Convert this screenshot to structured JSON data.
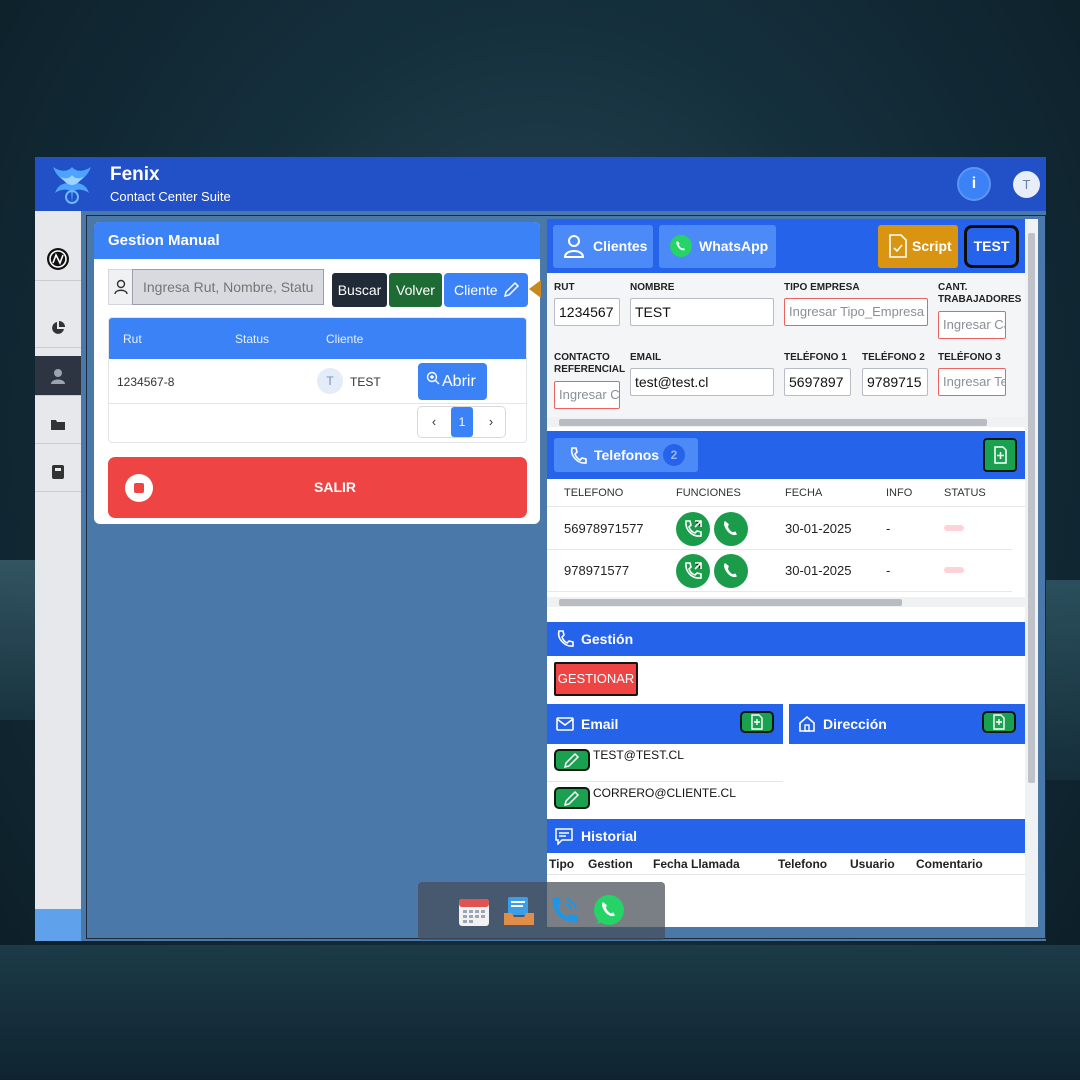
{
  "app": {
    "title": "Fenix",
    "subtitle": "Contact Center Suite",
    "user_initial": "T",
    "info_icon": "i"
  },
  "sidebar": {
    "items": [
      "brand-icon",
      "pie-chart-icon",
      "user-icon",
      "folder-icon",
      "book-icon"
    ]
  },
  "gestion_manual": {
    "title": "Gestion Manual",
    "search_placeholder": "Ingresa Rut, Nombre, Status",
    "buttons": {
      "buscar": "Buscar",
      "volver": "Volver",
      "cliente": "Cliente"
    },
    "table": {
      "headers": [
        "Rut",
        "Status",
        "Cliente"
      ],
      "rows": [
        {
          "rut": "1234567-8",
          "status": "",
          "avatar": "T",
          "cliente": "TEST",
          "action": "Abrir"
        }
      ]
    },
    "pagination": {
      "current": "1"
    },
    "salir": "SALIR"
  },
  "cliente_panel": {
    "tabs": {
      "clientes": "Clientes",
      "whatsapp": "WhatsApp",
      "script": "Script",
      "test": "TEST"
    },
    "form": {
      "rut": {
        "label": "RUT",
        "value": "1234567"
      },
      "nombre": {
        "label": "NOMBRE",
        "value": "TEST"
      },
      "tipo_empresa": {
        "label": "TIPO EMPRESA",
        "placeholder": "Ingresar Tipo_Empresa"
      },
      "cant_trabajadores": {
        "label": "CANT. TRABAJADORES",
        "placeholder": "Ingresar Cant"
      },
      "contacto_referencial": {
        "label": "CONTACTO REFERENCIAL",
        "placeholder": "Ingresar Contacto"
      },
      "email": {
        "label": "EMAIL",
        "value": "test@test.cl"
      },
      "telefono1": {
        "label": "TELÉFONO 1",
        "value": "5697897"
      },
      "telefono2": {
        "label": "TELÉFONO 2",
        "value": "9789715"
      },
      "telefono3": {
        "label": "TELÉFONO 3",
        "placeholder": "Ingresar Telefono"
      }
    },
    "telefonos": {
      "title": "Telefonos",
      "count": "2",
      "headers": [
        "TELEFONO",
        "FUNCIONES",
        "FECHA",
        "INFO",
        "STATUS"
      ],
      "rows": [
        {
          "telefono": "56978971577",
          "fecha": "30-01-2025",
          "info": "-"
        },
        {
          "telefono": "978971577",
          "fecha": "30-01-2025",
          "info": "-"
        }
      ]
    },
    "gestion": {
      "title": "Gestión",
      "button": "GESTIONAR"
    },
    "email": {
      "title": "Email",
      "items": [
        "TEST@TEST.CL",
        "CORRERO@CLIENTE.CL"
      ]
    },
    "direccion": {
      "title": "Dirección"
    },
    "historial": {
      "title": "Historial",
      "headers": [
        "Tipo",
        "Gestion",
        "Fecha Llamada",
        "Telefono",
        "Usuario",
        "Comentario"
      ]
    }
  },
  "dock": {
    "items": [
      "calendar-icon",
      "inbox-icon",
      "phone-icon",
      "whatsapp-icon"
    ]
  },
  "colors": {
    "primary": "#2563eb",
    "accent": "#3b82f6",
    "danger": "#ef4444",
    "success": "#1aa150",
    "warning": "#d99512"
  }
}
